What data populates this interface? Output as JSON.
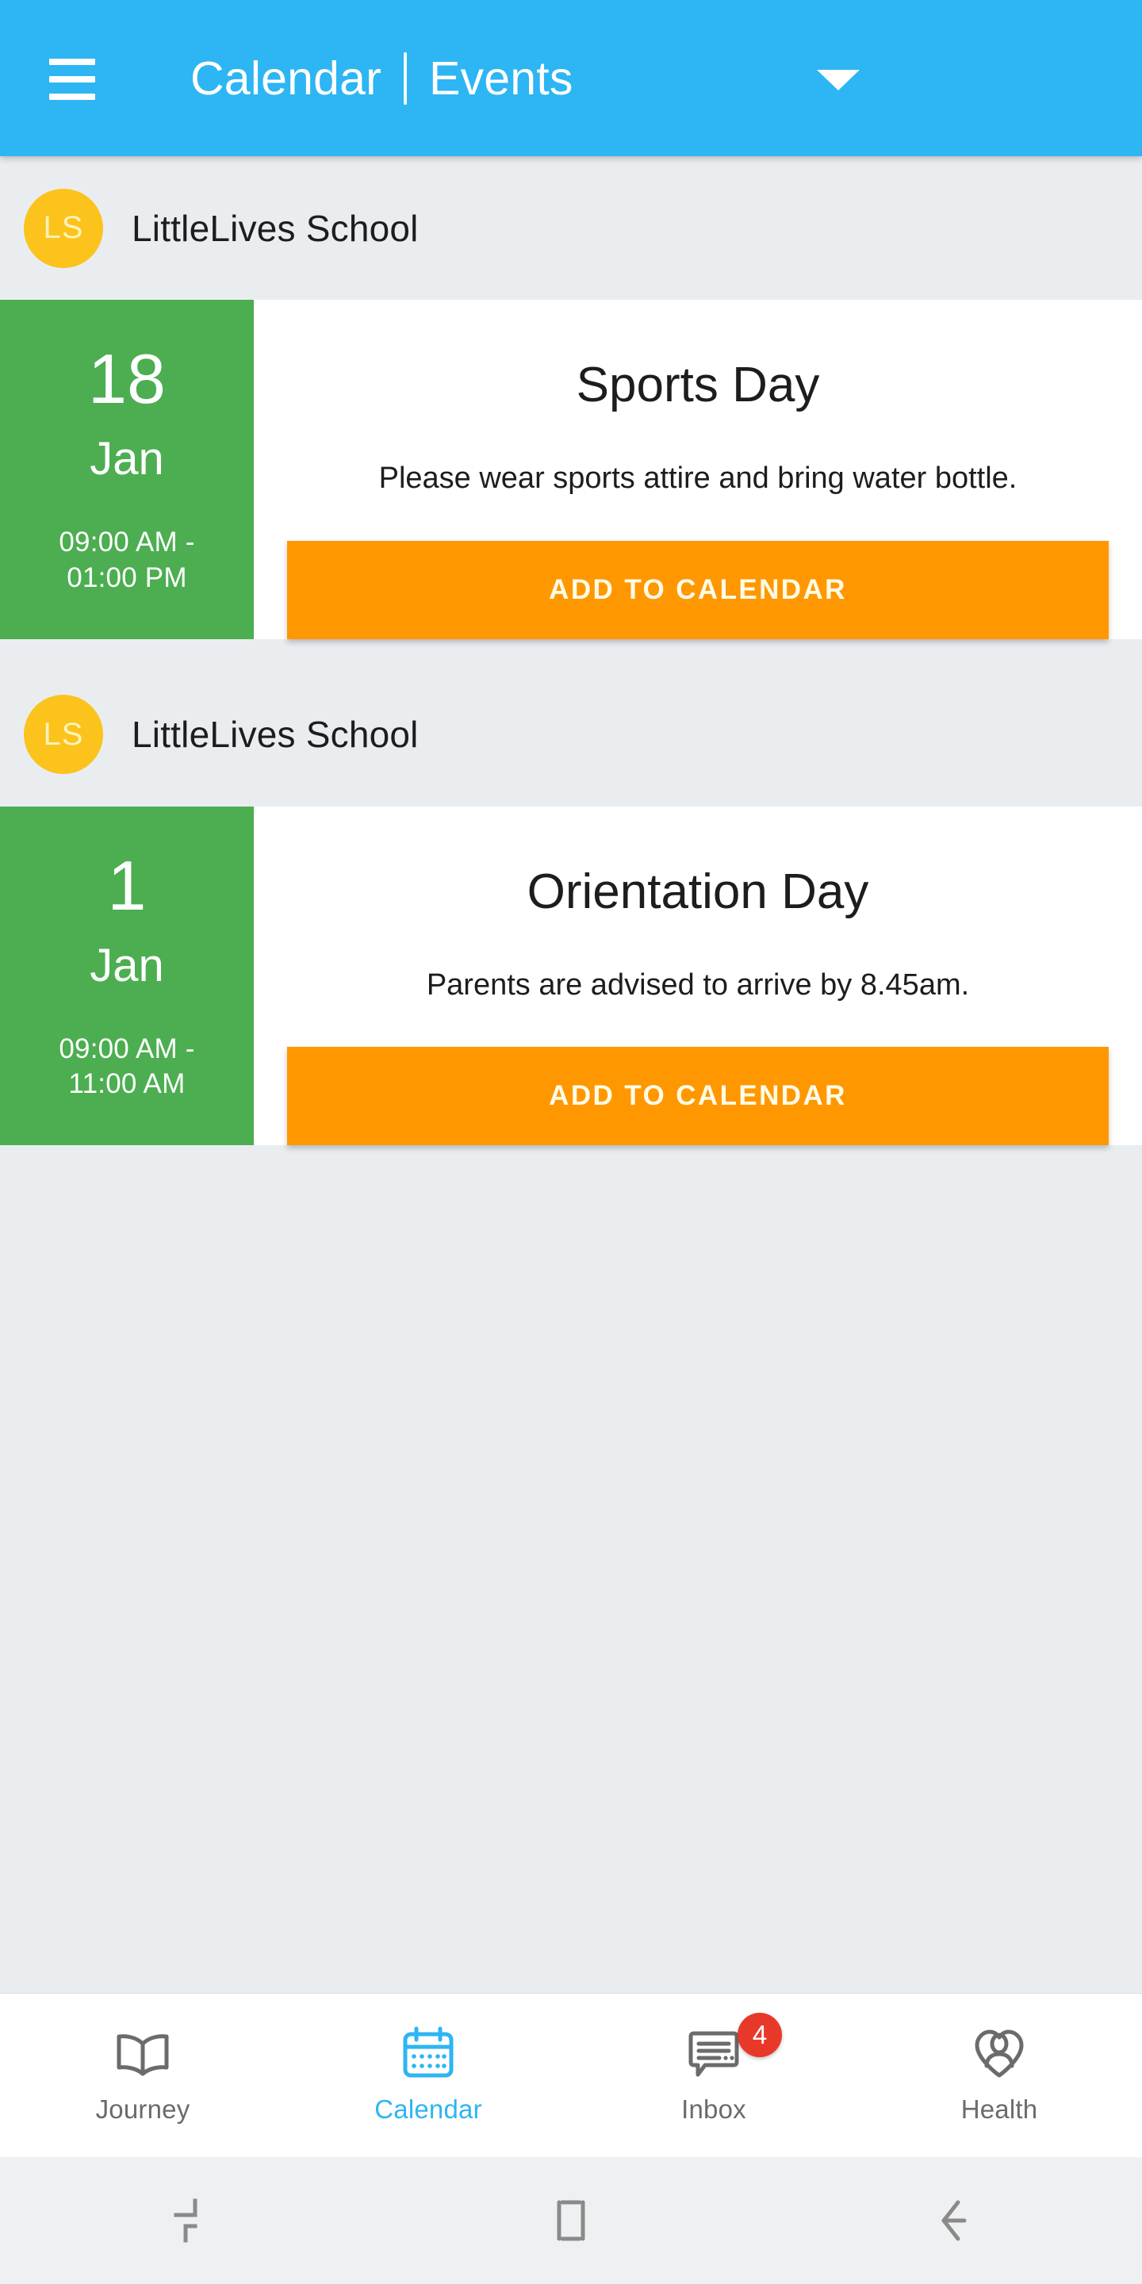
{
  "appbar": {
    "menu_icon": "hamburger-menu-icon",
    "title_primary": "Calendar",
    "title_secondary": "Events",
    "dropdown_icon": "chevron-down-icon",
    "background_color": "#2eb5f3",
    "text_color": "#ffffff"
  },
  "theme": {
    "page_background": "#eaedf0",
    "accent_blue": "#2eb5f3",
    "date_green": "#4cae50",
    "button_orange": "#ff9800",
    "avatar_yellow": "#fbc31c",
    "badge_red": "#e8382a",
    "card_white": "#ffffff"
  },
  "events": [
    {
      "school_name": "LittleLives School",
      "avatar_initials": "LS",
      "day": "18",
      "month": "Jan",
      "time_range": "09:00 AM -\n01:00 PM",
      "title": "Sports Day",
      "description": "Please wear sports attire and bring water bottle.",
      "action_label": "ADD TO CALENDAR"
    },
    {
      "school_name": "LittleLives School",
      "avatar_initials": "LS",
      "day": "1",
      "month": "Jan",
      "time_range": "09:00 AM -\n11:00 AM",
      "title": "Orientation Day",
      "description": "Parents are advised to arrive by 8.45am.",
      "action_label": "ADD TO CALENDAR"
    }
  ],
  "tabbar": {
    "items": [
      {
        "label": "Journey",
        "icon": "open-book-icon",
        "active": false,
        "badge": null
      },
      {
        "label": "Calendar",
        "icon": "calendar-icon",
        "active": true,
        "badge": null
      },
      {
        "label": "Inbox",
        "icon": "chat-bubble-icon",
        "active": false,
        "badge": "4"
      },
      {
        "label": "Health",
        "icon": "heart-person-icon",
        "active": false,
        "badge": null
      }
    ]
  },
  "sysnav": {
    "recents_icon": "recents-square-icon",
    "home_icon": "home-square-icon",
    "back_icon": "back-arrow-icon"
  }
}
